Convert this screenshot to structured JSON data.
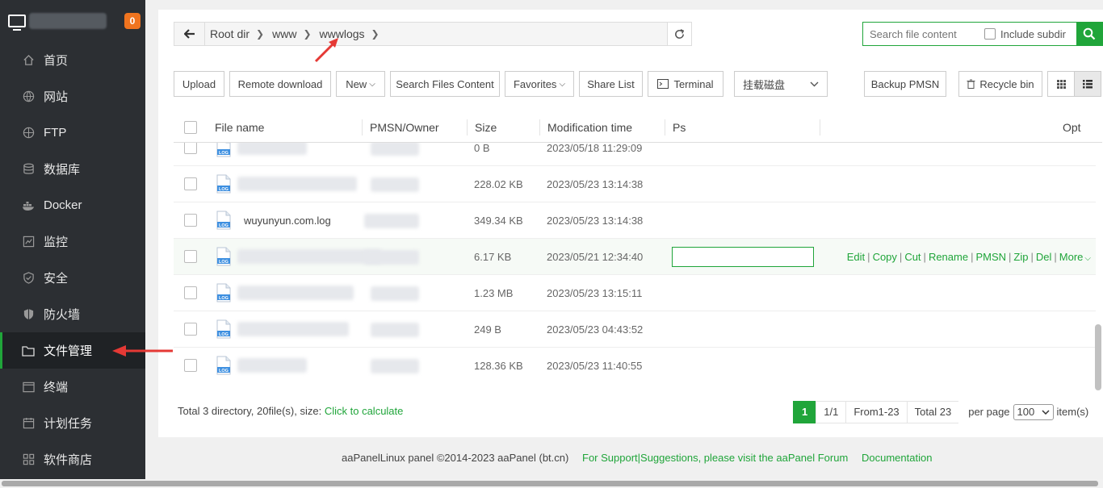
{
  "sidebar": {
    "badge": "0",
    "items": [
      {
        "label": "首页",
        "icon": "home-icon"
      },
      {
        "label": "网站",
        "icon": "globe-icon"
      },
      {
        "label": "FTP",
        "icon": "ftp-icon"
      },
      {
        "label": "数据库",
        "icon": "database-icon"
      },
      {
        "label": "Docker",
        "icon": "docker-icon"
      },
      {
        "label": "监控",
        "icon": "monitor-icon"
      },
      {
        "label": "安全",
        "icon": "shield-check-icon"
      },
      {
        "label": "防火墙",
        "icon": "firewall-icon"
      },
      {
        "label": "文件管理",
        "icon": "folder-icon"
      },
      {
        "label": "终端",
        "icon": "terminal-icon"
      },
      {
        "label": "计划任务",
        "icon": "clock-icon"
      },
      {
        "label": "软件商店",
        "icon": "apps-icon"
      }
    ]
  },
  "breadcrumb": {
    "segments": [
      "Root dir",
      "www",
      "wwwlogs"
    ]
  },
  "search": {
    "placeholder": "Search file content",
    "include_subdir": "Include subdir"
  },
  "toolbar": {
    "upload": "Upload",
    "remote_download": "Remote download",
    "new": "New",
    "search_files": "Search Files Content",
    "favorites": "Favorites",
    "share_list": "Share List",
    "terminal": "Terminal",
    "disk": "挂载磁盘",
    "backup": "Backup PMSN",
    "recycle": "Recycle bin"
  },
  "table": {
    "headers": {
      "name": "File name",
      "owner": "PMSN/Owner",
      "size": "Size",
      "mtime": "Modification time",
      "ps": "Ps",
      "opt": "Opt"
    },
    "rows": [
      {
        "name": "",
        "size": "0 B",
        "mtime": "2023/05/18 11:29:09"
      },
      {
        "name": "",
        "size": "228.02 KB",
        "mtime": "2023/05/23 13:14:38"
      },
      {
        "name": "wuyunyun.com.log",
        "size": "349.34 KB",
        "mtime": "2023/05/23 13:14:38"
      },
      {
        "name": "",
        "size": "6.17 KB",
        "mtime": "2023/05/21 12:34:40"
      },
      {
        "name": "",
        "size": "1.23 MB",
        "mtime": "2023/05/23 13:15:11"
      },
      {
        "name": "",
        "size": "249 B",
        "mtime": "2023/05/23 04:43:52"
      },
      {
        "name": "",
        "size": "128.36 KB",
        "mtime": "2023/05/23 11:40:55"
      }
    ],
    "row_actions": [
      "Edit",
      "Copy",
      "Cut",
      "Rename",
      "PMSN",
      "Zip",
      "Del",
      "More"
    ],
    "file_icon_label": "LOG"
  },
  "summary": {
    "text": "Total 3 directory, 20file(s), size:",
    "calc": "Click to calculate"
  },
  "pagination": {
    "current": "1",
    "pages": "1/1",
    "range": "From1-23",
    "total": "Total 23",
    "per_page_label": "per page",
    "per_page": "100",
    "items": "item(s)"
  },
  "footer": {
    "copyright": "aaPanelLinux panel ©2014-2023 aaPanel (bt.cn)",
    "support": "For Support|Suggestions, please visit the aaPanel Forum",
    "docs": "Documentation"
  },
  "colors": {
    "accent": "#20a53a",
    "sidebar": "#2c2f33",
    "badge": "#f0741f",
    "annotation_arrow": "#e53935"
  }
}
